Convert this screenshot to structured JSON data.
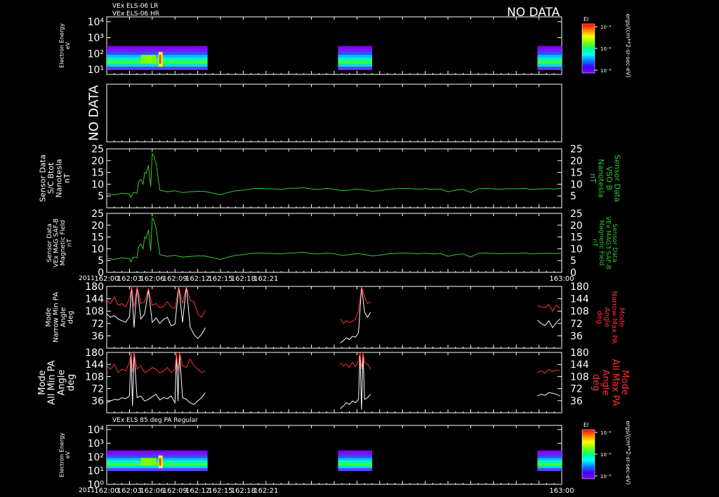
{
  "header": {
    "line1": "VEx ELS-06 LR",
    "line2": "VEx ELS-06 HR",
    "nodata_top": "NO DATA"
  },
  "time_axis": {
    "start_min": 0,
    "end_min": 60,
    "ticks": [
      "162:00",
      "162:03",
      "162:06",
      "162:09",
      "162:12",
      "162:15",
      "162:18",
      "162:21",
      "163:00"
    ],
    "year": "2011"
  },
  "colorbar": {
    "title": "El",
    "unit_label": "ergs/(cm**2-sr-sec-eV)",
    "ticks": [
      "10⁻⁴",
      "10⁻⁶",
      "10⁻⁸"
    ],
    "colors": [
      "#ff0000",
      "#ff8000",
      "#ffff00",
      "#80ff00",
      "#00ff80",
      "#00ffff",
      "#0080ff",
      "#4000ff",
      "#8000ff"
    ]
  },
  "panels": {
    "spectrogram_top": {
      "ylabel": [
        "Electron Energy",
        "eV"
      ],
      "yticks": [
        "10⁴",
        "10³",
        "10²",
        "10¹"
      ]
    },
    "nodata_panel": {
      "label": "NO DATA"
    },
    "bmag_sc": {
      "ylabel_left": [
        "Sensor Data",
        "S/C Btot",
        "Nanotesla",
        "nT"
      ],
      "ylabel_right": [
        "Sensor Data",
        "VSO B",
        "Nanotesla",
        "nT"
      ],
      "yticks": [
        "25",
        "20",
        "15",
        "10",
        "5"
      ]
    },
    "bmag_mag": {
      "ylabel_left": [
        "Sensor Data",
        "VEx MAG SAF-B",
        "Magnetic Field",
        "nT"
      ],
      "ylabel_right": [
        "Sensor Data",
        "VEx MAG3 SAF-B",
        "Magnetic Field",
        "nT"
      ],
      "yticks": [
        "25",
        "20",
        "15",
        "10",
        "5",
        "0"
      ]
    },
    "pa_narrow": {
      "ylabel_left": [
        "Mode",
        "Narrow Min PA",
        "Angle",
        "deg"
      ],
      "ylabel_right": [
        "Mode",
        "Narrow Max PA",
        "Angle",
        "deg"
      ],
      "yticks": [
        "180",
        "144",
        "108",
        "72",
        "36"
      ]
    },
    "pa_all": {
      "ylabel_left": [
        "Mode",
        "All Min PA",
        "Angle",
        "deg"
      ],
      "ylabel_right": [
        "Mode",
        "All Max PA",
        "Angle",
        "deg"
      ],
      "yticks": [
        "180",
        "144",
        "108",
        "72",
        "36"
      ]
    },
    "spectrogram_bottom": {
      "title": "VEx ELS 85 deg PA Regular",
      "ylabel": [
        "Electron Energy",
        "eV"
      ],
      "yticks": [
        "10⁴",
        "10³",
        "10²",
        "10¹",
        "10⁰"
      ]
    }
  },
  "chart_data": [
    {
      "type": "heatmap",
      "title": "VEx ELS-06 LR / HR",
      "ylabel": "Electron Energy eV",
      "yscale": "log",
      "ylim": [
        5,
        20000
      ],
      "xlim": [
        0,
        60
      ],
      "data_intervals_min": [
        [
          0,
          13.3
        ],
        [
          30.5,
          35.0
        ],
        [
          56.8,
          60
        ]
      ],
      "energy_range_ev": [
        10,
        300
      ]
    },
    {
      "type": "line",
      "ylabel": "Sensor Data S/C Btot Nanotesla nT",
      "ylim": [
        0,
        25
      ],
      "xlim": [
        0,
        60
      ],
      "series": [
        {
          "color": "#2ecc2e",
          "x": [
            0,
            1,
            2,
            3,
            3.2,
            3.5,
            4,
            4.2,
            4.5,
            4.8,
            5,
            5.2,
            5.5,
            5.8,
            6,
            6.2,
            6.5,
            7,
            8,
            9,
            10,
            11,
            12,
            13,
            14,
            15,
            16,
            17,
            18,
            19,
            20,
            21,
            22,
            23,
            24,
            25,
            26,
            27,
            28,
            29,
            30,
            31,
            32,
            33,
            34,
            35,
            36,
            37,
            38,
            39,
            40,
            41,
            42,
            43,
            44,
            45,
            46,
            47,
            48,
            49,
            50,
            51,
            52,
            53,
            54,
            55,
            56,
            57,
            58,
            59,
            60
          ],
          "y": [
            6,
            5.5,
            6.2,
            5.8,
            4.5,
            6.5,
            6.2,
            11,
            12,
            10,
            15,
            14.5,
            18,
            9,
            23,
            22,
            19,
            7.5,
            6.8,
            7.2,
            6.5,
            6.8,
            7,
            6.9,
            6.2,
            5.5,
            6.5,
            7.2,
            7.5,
            8,
            8.2,
            8.1,
            8,
            7.8,
            8.2,
            8.3,
            8.5,
            8,
            7.8,
            8.2,
            7.9,
            7.2,
            7.5,
            8,
            7.6,
            7,
            7.3,
            7.8,
            8,
            8.2,
            8.1,
            7.9,
            8.1,
            7.8,
            8,
            6.8,
            7.5,
            7.8,
            6.5,
            8,
            8.2,
            8,
            7.9,
            8.1,
            8,
            8.2,
            7.8,
            8,
            8.1,
            8,
            8.2
          ]
        }
      ]
    },
    {
      "type": "line",
      "ylabel": "Sensor Data VEx MAG SAF-B Magnetic Field nT",
      "ylim": [
        0,
        25
      ],
      "xlim": [
        0,
        60
      ],
      "series": [
        {
          "color": "#2ecc2e",
          "x": [
            0,
            1,
            2,
            3,
            3.2,
            3.5,
            4,
            4.2,
            4.5,
            4.8,
            5,
            5.2,
            5.5,
            5.8,
            6,
            6.2,
            6.5,
            7,
            8,
            9,
            10,
            11,
            12,
            13,
            14,
            15,
            16,
            17,
            18,
            19,
            20,
            21,
            22,
            23,
            24,
            25,
            26,
            27,
            28,
            29,
            30,
            31,
            32,
            33,
            34,
            35,
            36,
            37,
            38,
            39,
            40,
            41,
            42,
            43,
            44,
            45,
            46,
            47,
            48,
            49,
            50,
            51,
            52,
            53,
            54,
            55,
            56,
            57,
            58,
            59,
            60
          ],
          "y": [
            6,
            5.5,
            6.2,
            5.8,
            4.5,
            6.5,
            6.2,
            11,
            12,
            10,
            15,
            14.5,
            18,
            9,
            23,
            22,
            19,
            7.5,
            6.8,
            7.2,
            6.5,
            6.8,
            7,
            6.9,
            6.2,
            5.5,
            6.5,
            7.2,
            7.5,
            8,
            8.2,
            8.1,
            8,
            7.8,
            8.2,
            8.3,
            8.5,
            8,
            7.8,
            8.2,
            7.9,
            7.2,
            7.5,
            8,
            7.6,
            7,
            7.3,
            7.8,
            8,
            8.2,
            8.1,
            7.9,
            8.1,
            7.8,
            8,
            6.8,
            7.5,
            7.8,
            6.5,
            8,
            8.2,
            8,
            7.9,
            8.1,
            8,
            8.2,
            7.8,
            8,
            8.1,
            8,
            8.2
          ]
        }
      ]
    },
    {
      "type": "line",
      "ylabel": "Mode Narrow Min PA Angle deg",
      "ylim": [
        0,
        180
      ],
      "xlim": [
        0,
        60
      ],
      "series": [
        {
          "color": "#ffffff",
          "x": [
            0,
            0.5,
            1,
            1.5,
            2,
            2.5,
            3,
            3.3,
            3.6,
            4,
            4.5,
            5,
            5.5,
            6,
            6.5,
            7,
            7.5,
            8,
            8.5,
            9,
            9.5,
            10,
            10.5,
            11,
            11.5,
            12,
            12.5,
            13
          ],
          "y": [
            100,
            90,
            95,
            85,
            80,
            75,
            92,
            180,
            60,
            180,
            85,
            100,
            170,
            75,
            88,
            72,
            84,
            90,
            65,
            70,
            180,
            75,
            180,
            62,
            40,
            28,
            40,
            60
          ]
        },
        {
          "color": "#ff3030",
          "x": [
            0,
            0.5,
            1,
            1.5,
            2,
            2.5,
            3,
            3.3,
            3.6,
            4,
            4.5,
            5,
            5.5,
            6,
            6.5,
            7,
            7.5,
            8,
            8.5,
            9,
            9.5,
            10,
            10.5,
            11,
            11.5,
            12,
            12.5,
            13
          ],
          "y": [
            140,
            130,
            150,
            125,
            130,
            120,
            145,
            180,
            120,
            180,
            130,
            135,
            175,
            125,
            130,
            118,
            122,
            135,
            120,
            115,
            180,
            130,
            180,
            140,
            135,
            100,
            90,
            110
          ]
        },
        {
          "color": "#ffffff",
          "x": [
            30.8,
            31.2,
            31.6,
            32,
            32.4,
            32.8,
            33.2,
            33.6,
            34,
            34.4,
            34.8
          ],
          "y": [
            15,
            22,
            30,
            25,
            35,
            32,
            45,
            180,
            105,
            90,
            105
          ]
        },
        {
          "color": "#ff3030",
          "x": [
            30.8,
            31.2,
            31.6,
            32,
            32.4,
            32.8,
            33.2,
            33.6,
            34,
            34.4,
            34.8
          ],
          "y": [
            85,
            72,
            80,
            75,
            78,
            85,
            110,
            180,
            150,
            130,
            135
          ]
        },
        {
          "color": "#ffffff",
          "x": [
            56.8,
            57.3,
            57.8,
            58.3,
            58.8,
            59.3,
            59.8
          ],
          "y": [
            82,
            72,
            66,
            80,
            60,
            75,
            85
          ]
        },
        {
          "color": "#ff3030",
          "x": [
            56.8,
            57.3,
            57.8,
            58.3,
            58.8,
            59.3,
            59.8
          ],
          "y": [
            125,
            120,
            118,
            128,
            108,
            125,
            115
          ]
        }
      ]
    },
    {
      "type": "line",
      "ylabel": "Mode All Min PA Angle deg",
      "ylim": [
        0,
        180
      ],
      "xlim": [
        0,
        60
      ],
      "series": [
        {
          "color": "#ffffff",
          "x": [
            0,
            0.5,
            1,
            1.5,
            2,
            2.5,
            3,
            3.2,
            3.4,
            3.6,
            4,
            4.5,
            5,
            5.5,
            6,
            6.5,
            7,
            7.5,
            8,
            8.5,
            9,
            9.2,
            9.4,
            9.6,
            10,
            10.5,
            11,
            11.5,
            12,
            12.5,
            13
          ],
          "y": [
            30,
            35,
            40,
            38,
            45,
            42,
            50,
            180,
            20,
            180,
            45,
            50,
            35,
            40,
            48,
            55,
            38,
            45,
            42,
            50,
            30,
            180,
            35,
            180,
            45,
            40,
            30,
            25,
            35,
            45,
            60
          ]
        },
        {
          "color": "#ff3030",
          "x": [
            0,
            0.5,
            1,
            1.5,
            2,
            2.5,
            3,
            3.2,
            3.4,
            3.6,
            4,
            4.5,
            5,
            5.5,
            6,
            6.5,
            7,
            7.5,
            8,
            8.5,
            9,
            9.2,
            9.4,
            9.6,
            10,
            10.5,
            11,
            11.5,
            12,
            12.5,
            13
          ],
          "y": [
            140,
            130,
            145,
            120,
            130,
            125,
            150,
            180,
            120,
            180,
            130,
            140,
            120,
            125,
            135,
            130,
            118,
            125,
            135,
            120,
            130,
            180,
            125,
            180,
            140,
            135,
            160,
            140,
            130,
            120,
            125
          ]
        },
        {
          "color": "#ffffff",
          "x": [
            30.8,
            31.2,
            31.6,
            32,
            32.4,
            32.8,
            33.2,
            33.4,
            33.6,
            33.8,
            34,
            34.4,
            34.8
          ],
          "y": [
            12,
            20,
            30,
            25,
            35,
            30,
            40,
            180,
            10,
            180,
            40,
            45,
            55
          ]
        },
        {
          "color": "#ff3030",
          "x": [
            30.8,
            31.2,
            31.6,
            32,
            32.4,
            32.8,
            33.2,
            33.4,
            33.6,
            33.8,
            34,
            34.4,
            34.8
          ],
          "y": [
            150,
            140,
            145,
            135,
            150,
            138,
            155,
            180,
            130,
            180,
            150,
            145,
            130
          ]
        },
        {
          "color": "#ffffff",
          "x": [
            56.8,
            57.3,
            57.8,
            58.3,
            58.8,
            59.3,
            59.8
          ],
          "y": [
            50,
            55,
            52,
            60,
            58,
            55,
            50
          ]
        },
        {
          "color": "#ff3030",
          "x": [
            56.8,
            57.3,
            57.8,
            58.3,
            58.8,
            59.3,
            59.8
          ],
          "y": [
            120,
            125,
            118,
            130,
            122,
            128,
            125
          ]
        }
      ]
    },
    {
      "type": "heatmap",
      "title": "VEx ELS 85 deg PA Regular",
      "ylabel": "Electron Energy eV",
      "yscale": "log",
      "ylim": [
        1,
        20000
      ],
      "xlim": [
        0,
        60
      ],
      "data_intervals_min": [
        [
          0,
          13.3
        ],
        [
          30.5,
          35.0
        ],
        [
          56.8,
          60
        ]
      ],
      "energy_range_ev": [
        10,
        300
      ]
    }
  ]
}
